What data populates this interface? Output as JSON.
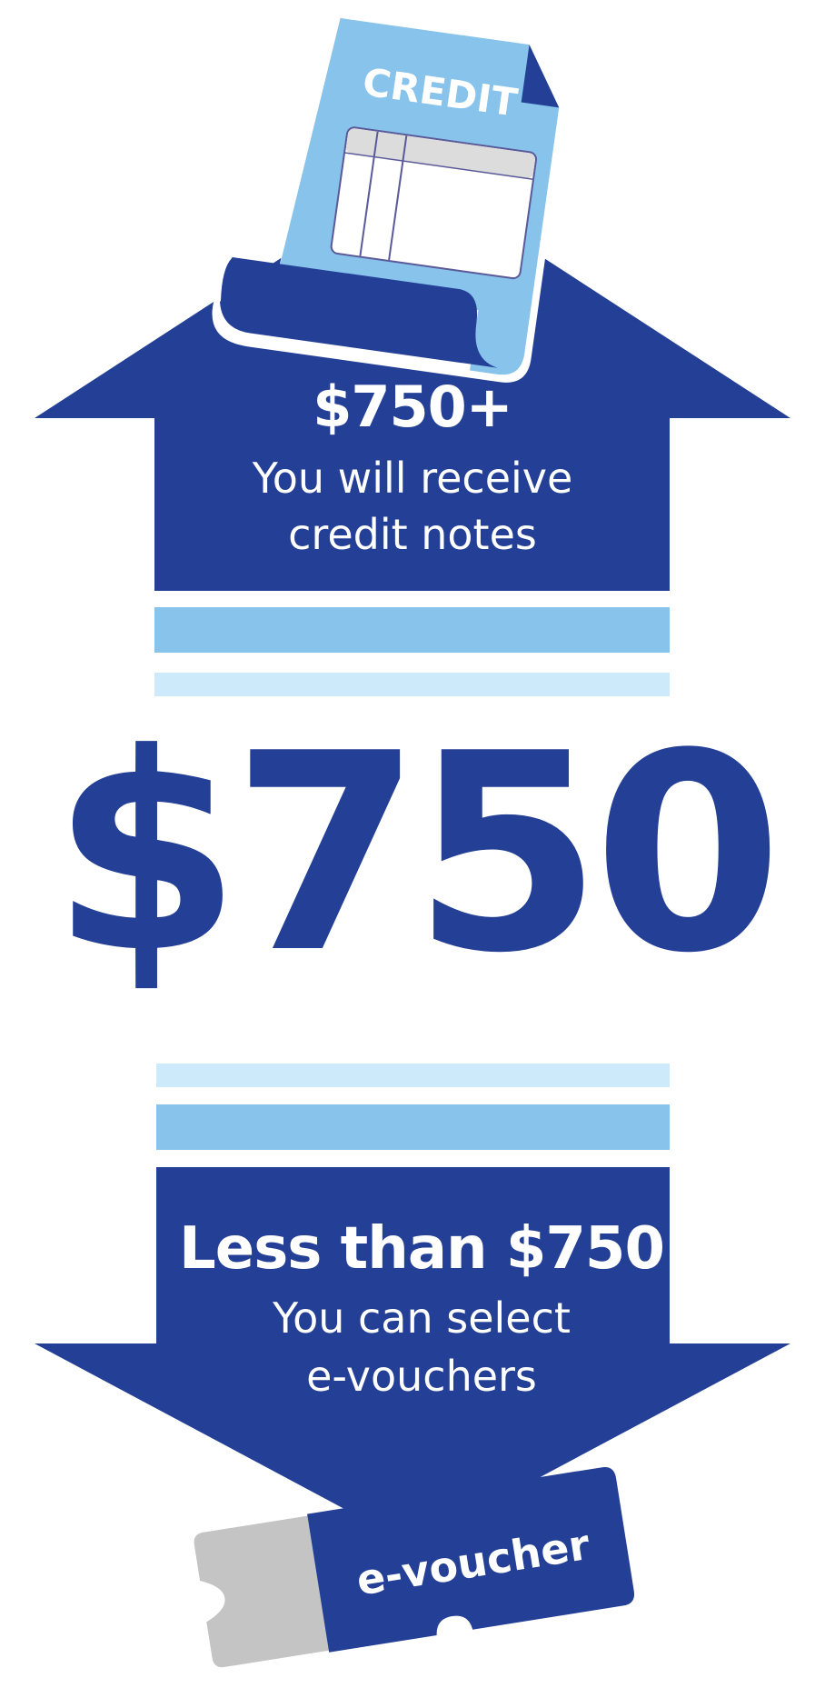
{
  "upper": {
    "amount": "$750+",
    "line1": "You will receive",
    "line2": "credit notes"
  },
  "threshold": "$750",
  "lower": {
    "amount": "Less than $750",
    "line1": "You can select",
    "line2": "e-vouchers"
  },
  "credit_document": {
    "label": "CREDIT",
    "icon": "credit-note-document"
  },
  "voucher": {
    "label": "e-voucher",
    "icon": "voucher-ticket"
  },
  "colors": {
    "dark_blue": "#233f96",
    "mid_blue": "#87c3ea",
    "light_blue": "#cdeafb",
    "ticket_grey": "#c4c4c4",
    "text_white": "#ffffff"
  }
}
